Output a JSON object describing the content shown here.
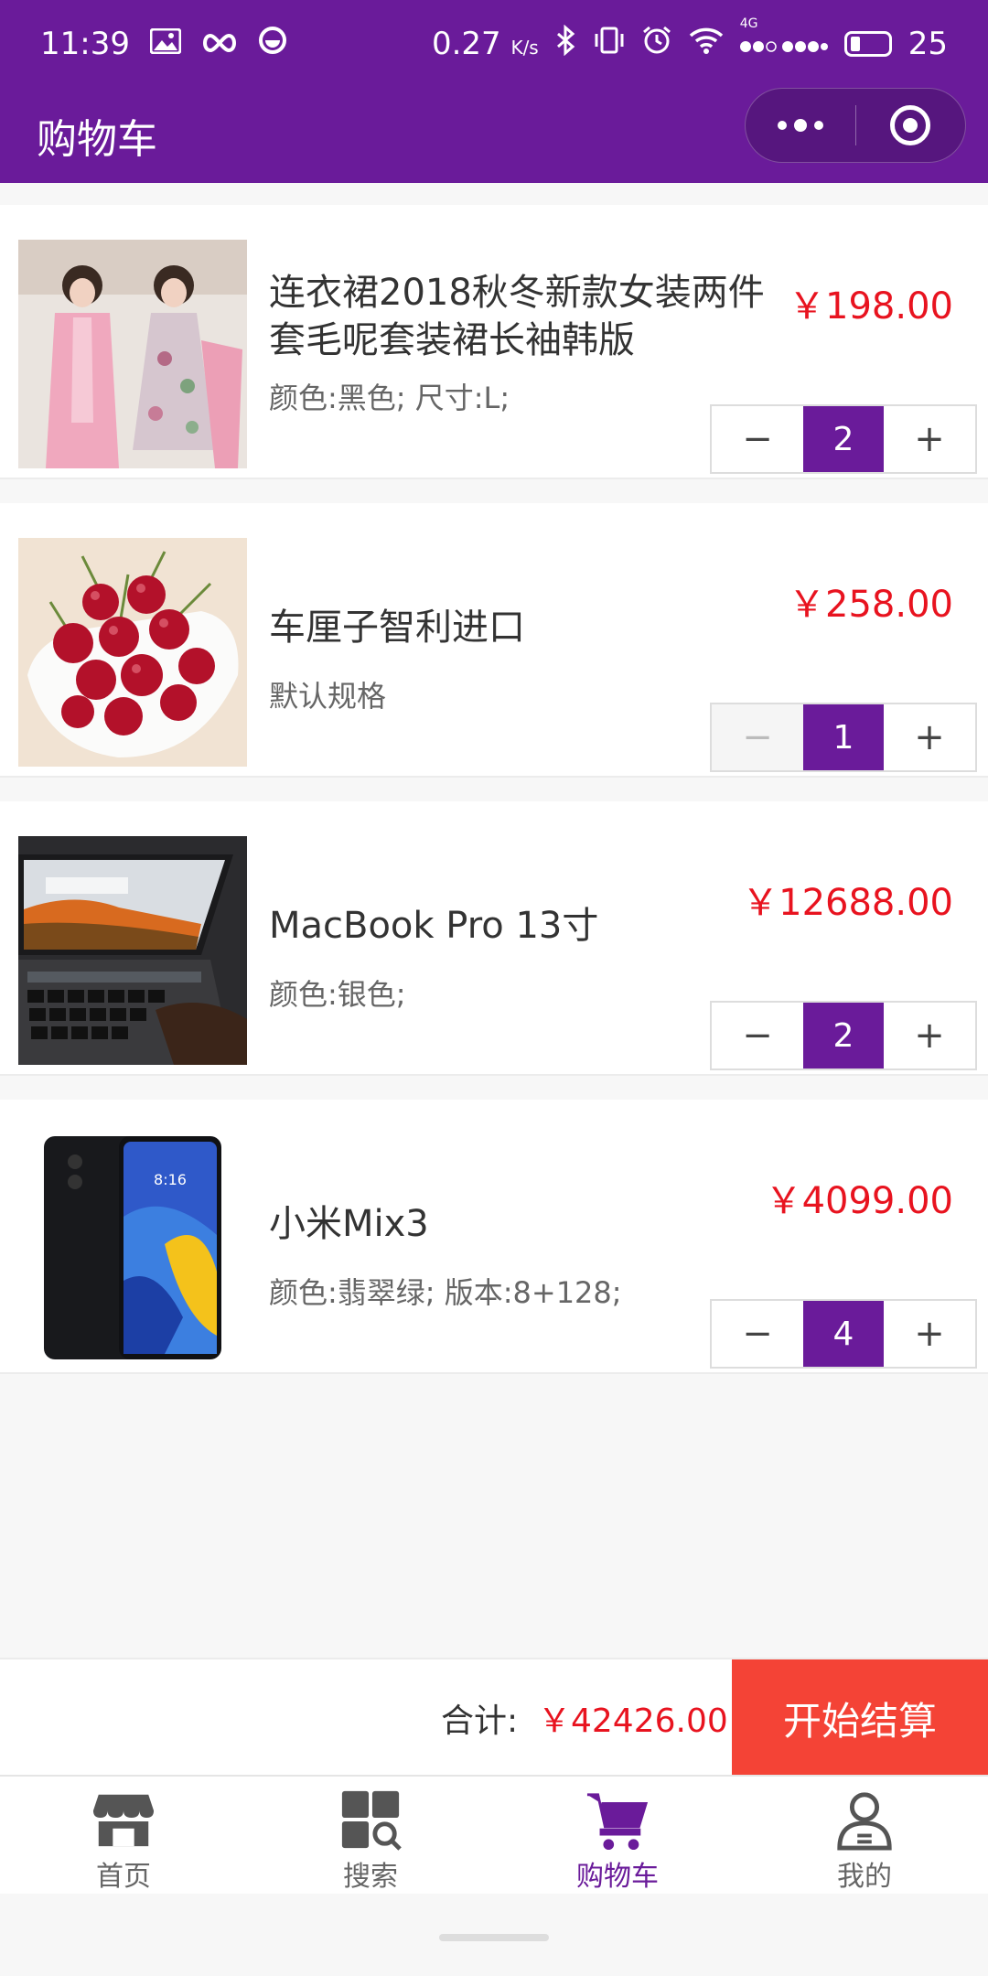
{
  "status_bar": {
    "time": "11:39",
    "net_speed": "0.27",
    "net_unit": "K/s",
    "signal": "4G",
    "battery": "25"
  },
  "header": {
    "title": "购物车"
  },
  "items": [
    {
      "name": "连衣裙2018秋冬新款女装两件套毛呢套装裙长袖韩版",
      "spec": "颜色:黑色; 尺寸:L;",
      "price": "￥198.00",
      "qty": "2",
      "minus_disabled": false,
      "image_icon": "dress-photo"
    },
    {
      "name": "车厘子智利进口",
      "spec": "默认规格",
      "price": "￥258.00",
      "qty": "1",
      "minus_disabled": true,
      "image_icon": "cherries-photo"
    },
    {
      "name": "MacBook Pro 13寸",
      "spec": "颜色:银色;",
      "price": "￥12688.00",
      "qty": "2",
      "minus_disabled": false,
      "image_icon": "laptop-photo"
    },
    {
      "name": "小米Mix3",
      "spec": "颜色:翡翠绿; 版本:8+128;",
      "price": "￥4099.00",
      "qty": "4",
      "minus_disabled": false,
      "image_icon": "phone-photo"
    }
  ],
  "stepper": {
    "minus": "−",
    "plus": "+"
  },
  "checkout": {
    "total_label": "合计:",
    "total_value": "￥42426.00",
    "button": "开始结算"
  },
  "tabs": [
    {
      "label": "首页",
      "icon": "store-icon",
      "active": false
    },
    {
      "label": "搜索",
      "icon": "grid-search-icon",
      "active": false
    },
    {
      "label": "购物车",
      "icon": "cart-icon",
      "active": true
    },
    {
      "label": "我的",
      "icon": "user-icon",
      "active": false
    }
  ],
  "colors": {
    "primary": "#6a1b9a",
    "price": "#e8131f",
    "checkout": "#f44336"
  }
}
